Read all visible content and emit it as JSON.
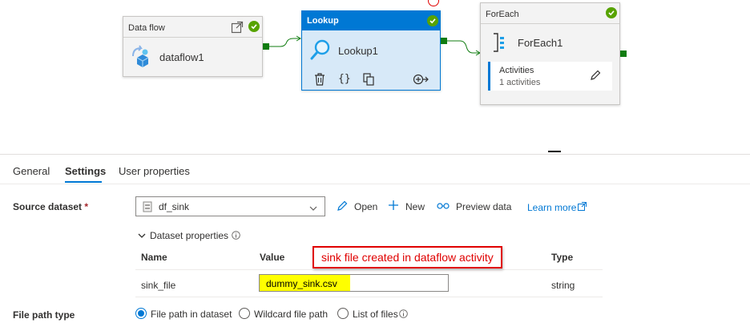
{
  "pipeline": {
    "dataflow_node": {
      "title": "Data flow",
      "name": "dataflow1"
    },
    "lookup_node": {
      "title": "Lookup",
      "name": "Lookup1"
    },
    "foreach_node": {
      "title": "ForEach",
      "name": "ForEach1",
      "activities_label": "Activities",
      "activities_count": "1 activities"
    }
  },
  "tabs": [
    {
      "label": "General"
    },
    {
      "label": "Settings"
    },
    {
      "label": "User properties"
    }
  ],
  "settings": {
    "source_dataset_label": "Source dataset",
    "required_mark": "*",
    "dataset_value": "df_sink",
    "open_label": "Open",
    "new_label": "New",
    "preview_label": "Preview data",
    "learn_more_label": "Learn more",
    "dataset_properties_label": "Dataset properties",
    "columns": {
      "name": "Name",
      "value": "Value",
      "type": "Type"
    },
    "row": {
      "name": "sink_file",
      "value": "dummy_sink.csv",
      "type": "string"
    },
    "callout_text": "sink file created in dataflow activity",
    "file_path_type_label": "File path type",
    "radio_options": [
      "File path in dataset",
      "Wildcard file path",
      "List of files"
    ]
  },
  "colors": {
    "accent": "#0078d4",
    "success": "#57a300",
    "connector": "#107c10",
    "callout": "#e00000",
    "highlight": "#ffff00"
  }
}
